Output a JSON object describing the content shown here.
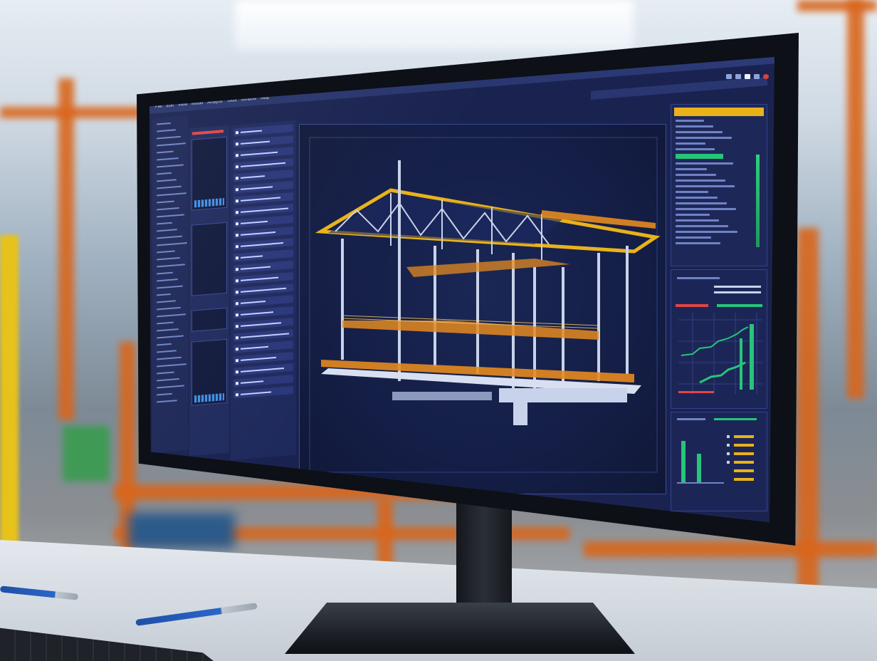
{
  "app": {
    "menu_items": [
      "File",
      "Edit",
      "View",
      "Model",
      "Analyze",
      "Tools",
      "Window",
      "Help"
    ],
    "toolbar_icons": [
      "undo-icon",
      "redo-icon",
      "save-icon",
      "settings-icon",
      "close-icon"
    ]
  },
  "colors": {
    "screen_bg": "#1a2350",
    "viewport_bg": "#141e46",
    "accent_yellow": "#e9b21a",
    "accent_green": "#27c47a",
    "accent_red": "#e04646",
    "structure_orange": "#e58a1f",
    "structure_steel": "#c8d2ea"
  },
  "left_panel": {
    "row_count": 24
  },
  "right_panels": {
    "chart_series": [
      "step-line",
      "bars"
    ]
  },
  "scene": {
    "subject": "3D steel structure model",
    "background": "industrial warehouse with orange racking"
  }
}
